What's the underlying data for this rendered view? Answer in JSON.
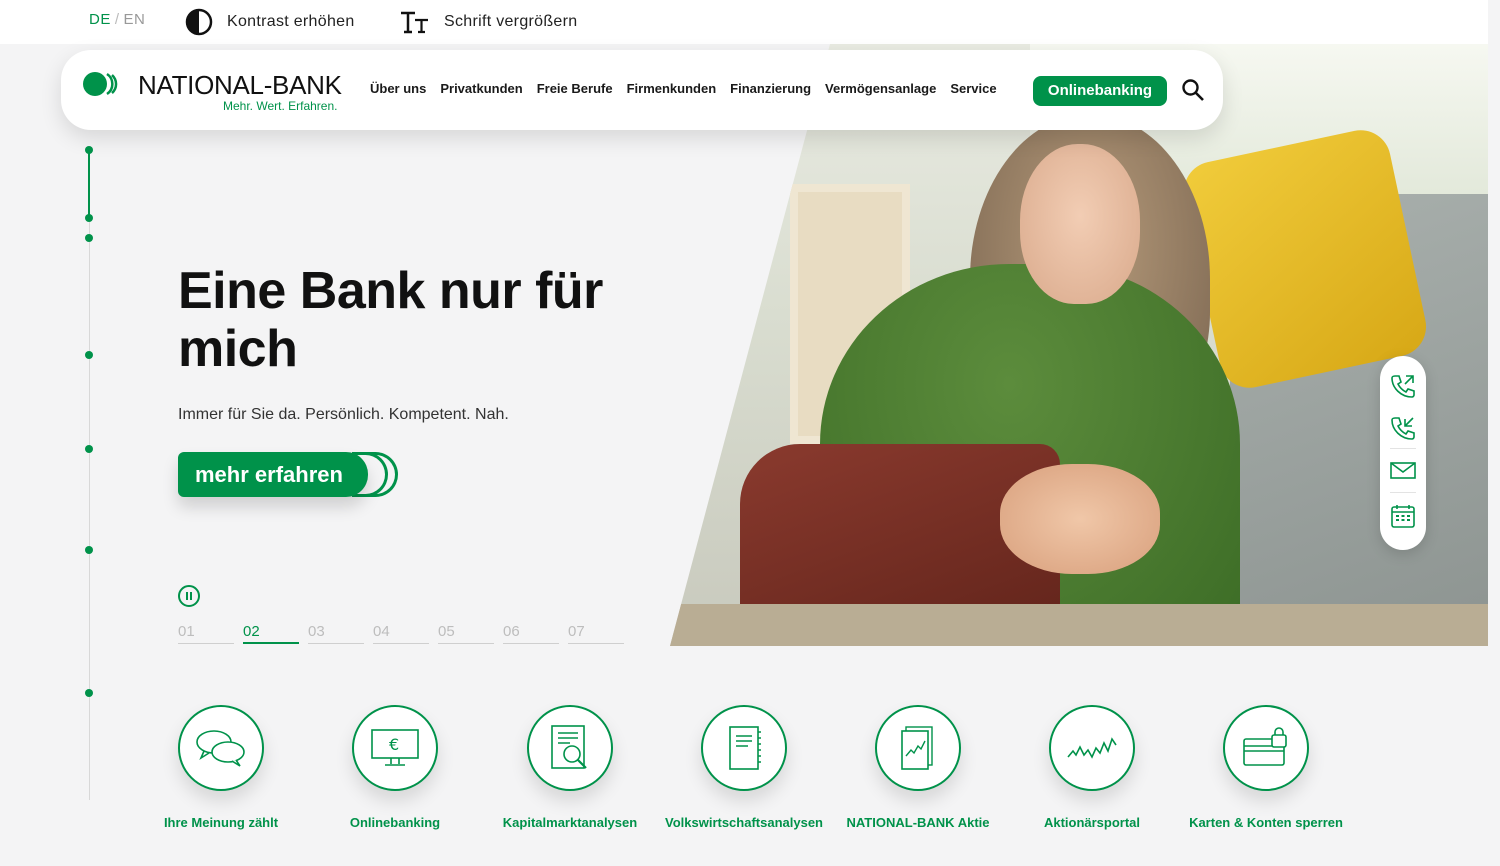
{
  "lang": {
    "de": "DE",
    "sep": "/",
    "en": "EN"
  },
  "accessibility": {
    "contrast": "Kontrast erhöhen",
    "fontsize": "Schrift vergrößern"
  },
  "logo": {
    "name": "NATIONAL-BANK",
    "tagline": "Mehr. Wert. Erfahren."
  },
  "nav": [
    "Über uns",
    "Privatkunden",
    "Freie Berufe",
    "Firmenkunden",
    "Finanzierung",
    "Vermögensanlage",
    "Service"
  ],
  "online_button": "Onlinebanking",
  "hero": {
    "headline": "Eine Bank nur für mich",
    "subline": "Immer für Sie da. Persönlich. Kompetent. Nah.",
    "cta": "mehr erfahren"
  },
  "slider": {
    "slides": [
      "01",
      "02",
      "03",
      "04",
      "05",
      "06",
      "07"
    ],
    "active_index": 1
  },
  "contact_icons": [
    "phone-outgoing-icon",
    "phone-incoming-icon",
    "mail-icon",
    "calendar-icon"
  ],
  "quick_links": [
    {
      "label": "Ihre Meinung zählt",
      "icon": "chat-bubbles-icon"
    },
    {
      "label": "Onlinebanking",
      "icon": "monitor-euro-icon"
    },
    {
      "label": "Kapitalmarktanalysen",
      "icon": "document-magnifier-icon"
    },
    {
      "label": "Volkswirtschaftsanalysen",
      "icon": "notebook-icon"
    },
    {
      "label": "NATIONAL-BANK Aktie",
      "icon": "stock-chart-document-icon"
    },
    {
      "label": "Aktionärsportal",
      "icon": "stock-line-icon"
    },
    {
      "label": "Karten & Konten sperren",
      "icon": "card-lock-icon"
    }
  ],
  "colors": {
    "brand_green": "#00924a",
    "background": "#f4f4f5",
    "text": "#1a1a1a"
  }
}
